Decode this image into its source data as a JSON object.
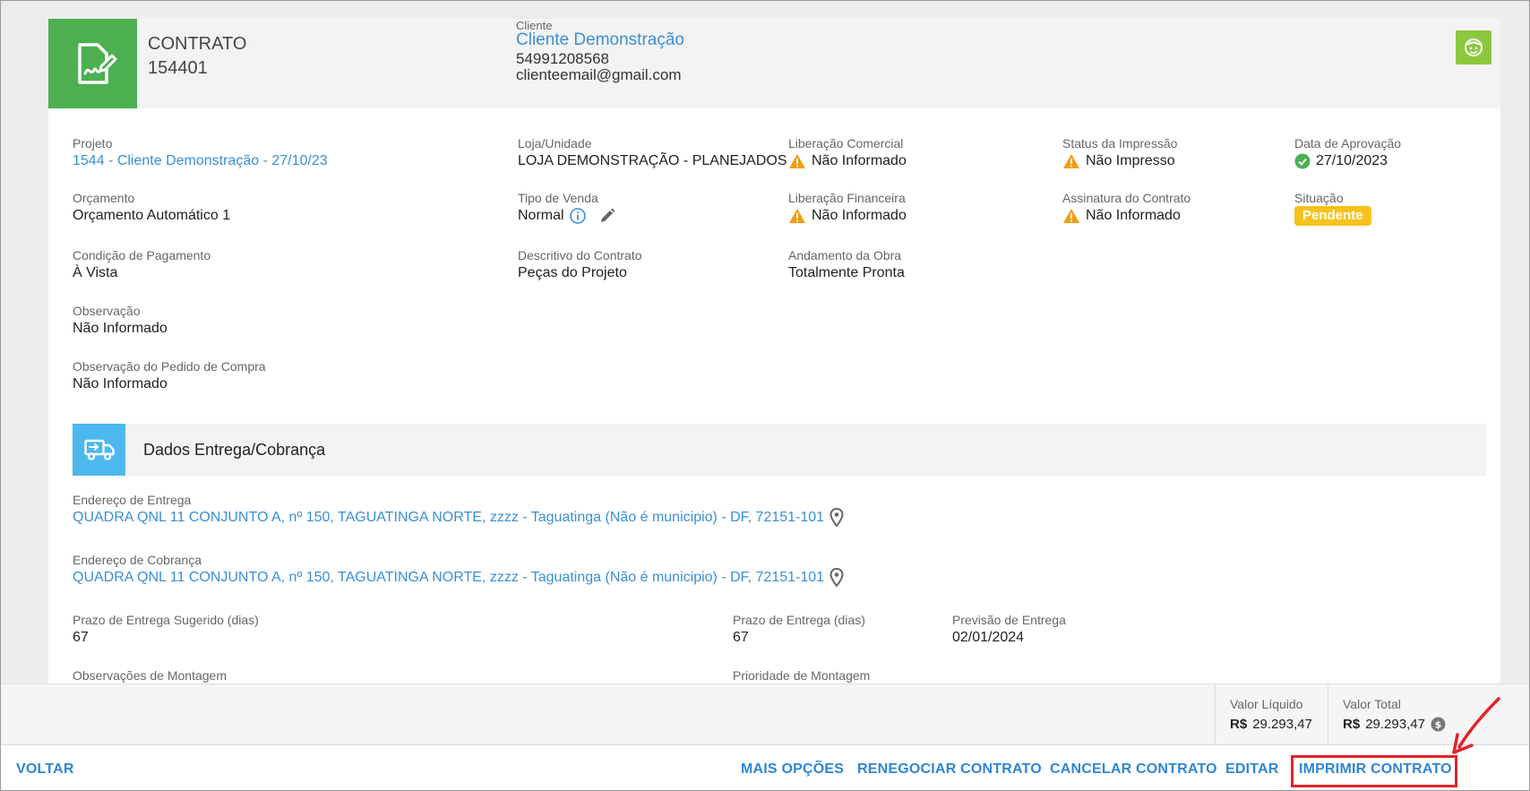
{
  "header": {
    "title": "CONTRATO",
    "number": "154401",
    "client_label": "Cliente",
    "client_name": "Cliente Demonstração",
    "client_phone": "54991208568",
    "client_email": "clienteemail@gmail.com"
  },
  "fields": {
    "projeto": {
      "label": "Projeto",
      "value": "1544 - Cliente Demonstração - 27/10/23"
    },
    "loja": {
      "label": "Loja/Unidade",
      "value": "LOJA DEMONSTRAÇÃO - PLANEJADOS"
    },
    "lib_comercial": {
      "label": "Liberação Comercial",
      "value": "Não Informado"
    },
    "status_impressao": {
      "label": "Status da Impressão",
      "value": "Não Impresso"
    },
    "data_aprovacao": {
      "label": "Data de Aprovação",
      "value": "27/10/2023"
    },
    "orcamento": {
      "label": "Orçamento",
      "value": "Orçamento Automático 1"
    },
    "tipo_venda": {
      "label": "Tipo de Venda",
      "value": "Normal"
    },
    "lib_financeira": {
      "label": "Liberação Financeira",
      "value": "Não Informado"
    },
    "assinatura": {
      "label": "Assinatura do Contrato",
      "value": "Não Informado"
    },
    "situacao": {
      "label": "Situação",
      "value": "Pendente"
    },
    "condicao": {
      "label": "Condição de Pagamento",
      "value": "À Vista"
    },
    "descritivo": {
      "label": "Descritivo do Contrato",
      "value": "Peças do Projeto"
    },
    "andamento": {
      "label": "Andamento da Obra",
      "value": "Totalmente Pronta"
    },
    "observacao": {
      "label": "Observação",
      "value": "Não Informado"
    },
    "obs_pedido": {
      "label": "Observação do Pedido de Compra",
      "value": "Não Informado"
    }
  },
  "section": {
    "title": "Dados Entrega/Cobrança"
  },
  "delivery": {
    "end_entrega": {
      "label": "Endereço de Entrega",
      "value": "QUADRA QNL 11 CONJUNTO A, nº 150, TAGUATINGA NORTE, zzzz - Taguatinga (Não é municipio) - DF, 72151-101"
    },
    "end_cobranca": {
      "label": "Endereço de Cobrança",
      "value": "QUADRA QNL 11 CONJUNTO A, nº 150, TAGUATINGA NORTE, zzzz - Taguatinga (Não é municipio) - DF, 72151-101"
    },
    "prazo_sugerido": {
      "label": "Prazo de Entrega Sugerido (dias)",
      "value": "67"
    },
    "prazo": {
      "label": "Prazo de Entrega (dias)",
      "value": "67"
    },
    "previsao": {
      "label": "Previsão de Entrega",
      "value": "02/01/2024"
    },
    "obs_montagem": {
      "label": "Observações de Montagem"
    },
    "prioridade": {
      "label": "Prioridade de Montagem"
    }
  },
  "totals": {
    "liquido": {
      "label": "Valor Líquido",
      "currency": "R$",
      "value": "29.293,47"
    },
    "total": {
      "label": "Valor Total",
      "currency": "R$",
      "value": "29.293,47"
    }
  },
  "actions": {
    "voltar": "VOLTAR",
    "mais_opcoes": "MAIS OPÇÕES",
    "renegociar": "RENEGOCIAR CONTRATO",
    "cancelar": "CANCELAR CONTRATO",
    "editar": "EDITAR",
    "imprimir": "IMPRIMIR CONTRATO"
  },
  "colors": {
    "green": "#4cb050",
    "blue_link": "#3a8fd6",
    "warning": "#f39c12",
    "badge": "#f7c21c",
    "annotation": "#e2242a"
  }
}
